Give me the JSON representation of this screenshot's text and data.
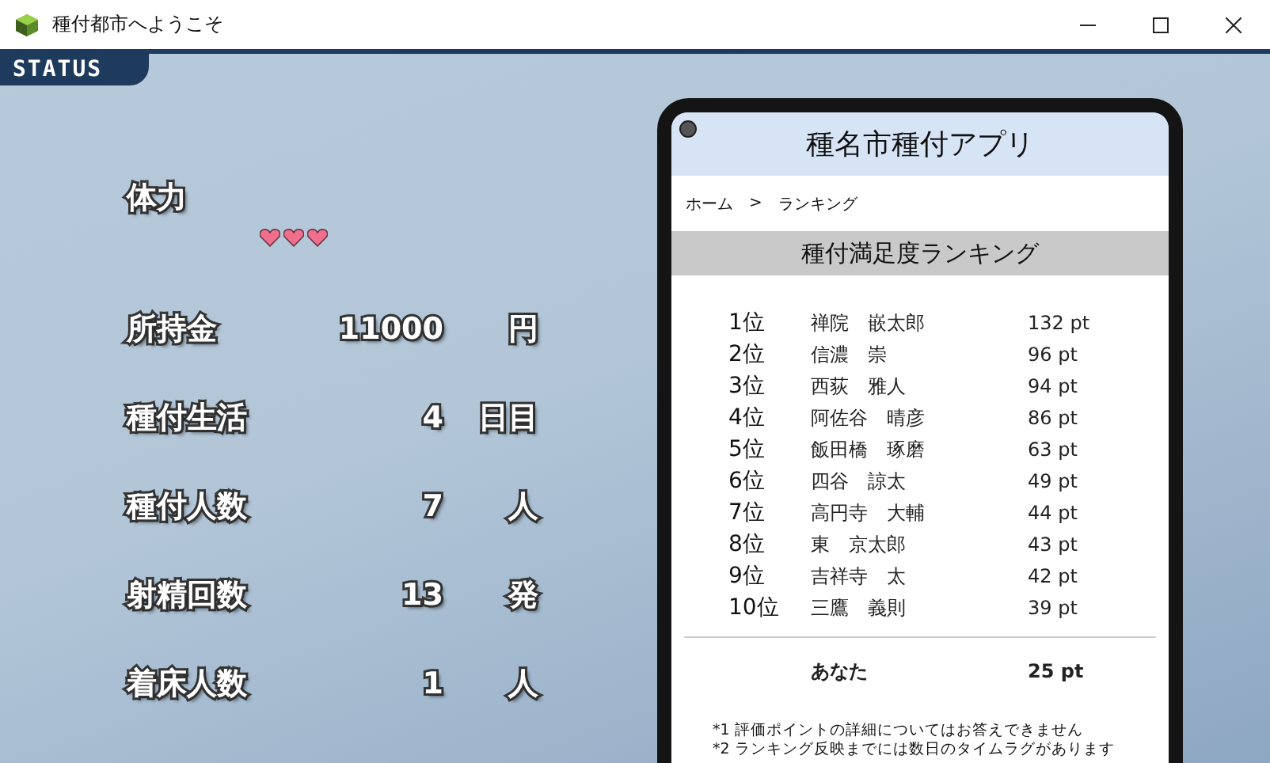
{
  "window": {
    "title": "種付都市へようこそ"
  },
  "status_tab": {
    "label": "STATUS"
  },
  "health": {
    "label": "体力",
    "stars": 3
  },
  "stats": [
    {
      "label": "所持金",
      "value": "11000",
      "unit": "円"
    },
    {
      "label": "種付生活",
      "value": "4",
      "unit": "日目"
    },
    {
      "label": "種付人数",
      "value": "7",
      "unit": "人"
    },
    {
      "label": "射精回数",
      "value": "13",
      "unit": "発"
    },
    {
      "label": "着床人数",
      "value": "1",
      "unit": "人"
    }
  ],
  "phone": {
    "app_title": "種名市種付アプリ",
    "breadcrumb": [
      "ホーム",
      "ランキング"
    ],
    "breadcrumb_separator": ">",
    "section_title": "種付満足度ランキング",
    "ranking": [
      {
        "rank": "1位",
        "name": "禅院　嵌太郎",
        "points": "132 pt"
      },
      {
        "rank": "2位",
        "name": "信濃　崇",
        "points": "96 pt"
      },
      {
        "rank": "3位",
        "name": "西荻　雅人",
        "points": "94 pt"
      },
      {
        "rank": "4位",
        "name": "阿佐谷　晴彦",
        "points": "86 pt"
      },
      {
        "rank": "5位",
        "name": "飯田橋　琢磨",
        "points": "63 pt"
      },
      {
        "rank": "6位",
        "name": "四谷　諒太",
        "points": "49 pt"
      },
      {
        "rank": "7位",
        "name": "高円寺　大輔",
        "points": "44 pt"
      },
      {
        "rank": "8位",
        "name": "東　京太郎",
        "points": "43 pt"
      },
      {
        "rank": "9位",
        "name": "吉祥寺　太",
        "points": "42 pt"
      },
      {
        "rank": "10位",
        "name": "三鷹　義則",
        "points": "39 pt"
      }
    ],
    "you": {
      "name": "あなた",
      "points": "25 pt"
    },
    "notes": [
      "*1 評価ポイントの詳細についてはお答えできません",
      "*2 ランキング反映までには数日のタイムラグがあります"
    ]
  }
}
